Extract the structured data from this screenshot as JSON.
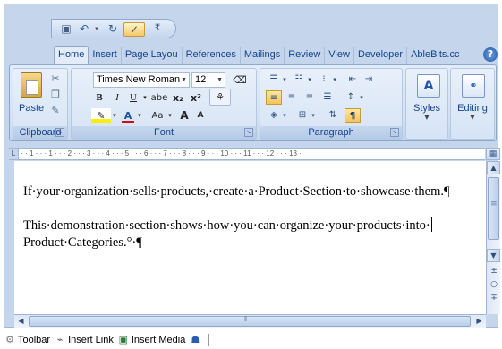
{
  "quick_access": {
    "save_icon": "save-icon",
    "undo_icon": "undo-icon",
    "redo_icon": "redo-icon",
    "spell_icon": "spelling-icon",
    "customize_icon": "customize-qat-icon"
  },
  "tabs": [
    {
      "label": "Home",
      "active": true
    },
    {
      "label": "Insert"
    },
    {
      "label": "Page Layou"
    },
    {
      "label": "References"
    },
    {
      "label": "Mailings"
    },
    {
      "label": "Review"
    },
    {
      "label": "View"
    },
    {
      "label": "Developer"
    },
    {
      "label": "AbleBits.cc"
    }
  ],
  "help_label": "?",
  "ribbon": {
    "clipboard": {
      "label": "Clipboard",
      "paste_label": "Paste"
    },
    "font": {
      "label": "Font",
      "font_name": "Times New Roman",
      "font_size": "12",
      "bold": "B",
      "italic": "I",
      "underline": "U",
      "strike": "abe",
      "subscript": "x₂",
      "superscript": "x²",
      "change_case": "Aa",
      "grow": "A",
      "shrink": "A",
      "font_color": "A"
    },
    "paragraph": {
      "label": "Paragraph",
      "pilcrow": "¶"
    },
    "styles": {
      "label": "Styles",
      "icon_text": "A"
    },
    "editing": {
      "label": "Editing",
      "icon_text": "A"
    }
  },
  "ruler_text": "· · 1 · · · 1 · · · 2 · · · 3 · · · 4 · · · 5 · · · 6 · · · 7 · · · 8 · · · 9 · · · 10 · · · 11 · · · 12 · · · 13 ·",
  "document": {
    "paragraph1": "If·your·organization·sells·products,·create·a·Product·Section·to·showcase·them.¶",
    "paragraph2_line1": "This·demonstration·section·shows·how·you·can·organize·your·products·into·",
    "paragraph2_line2": "Product·Categories.°·¶"
  },
  "bottom_toolbar": {
    "toolbar_label": "Toolbar",
    "insert_link_label": "Insert Link",
    "insert_media_label": "Insert Media"
  },
  "colors": {
    "ribbon_bg": "#dbe7f6",
    "accent": "#15428b",
    "highlight": "#f6c25b"
  }
}
